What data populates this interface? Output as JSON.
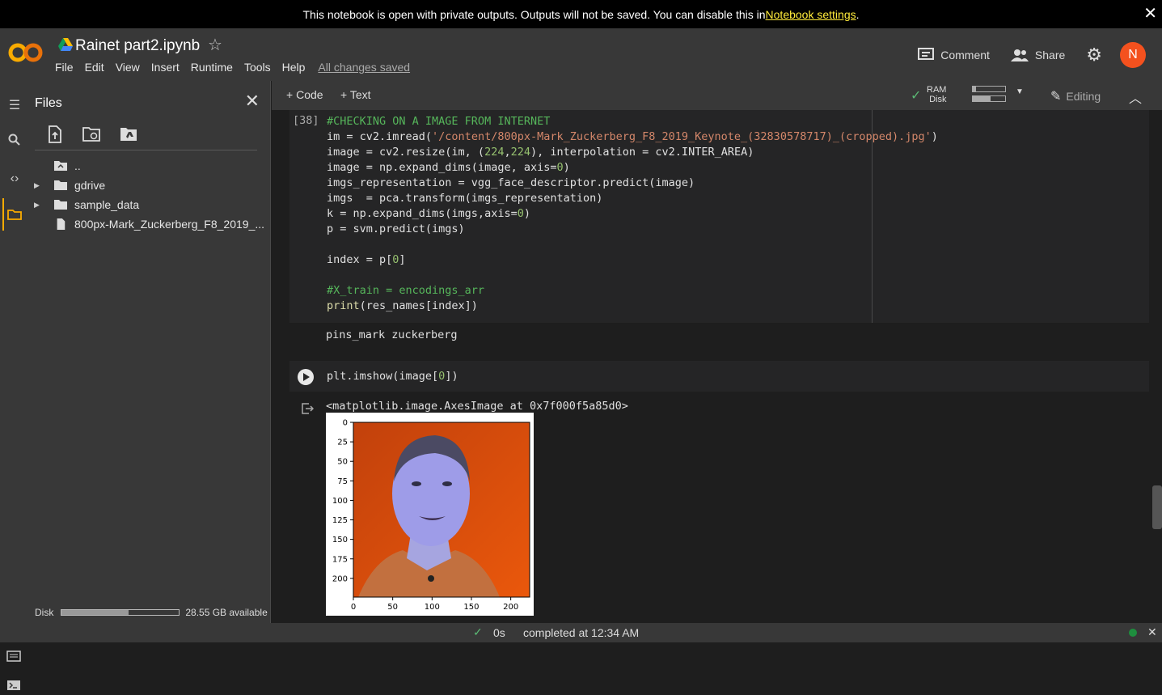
{
  "banner": {
    "text": "This notebook is open with private outputs. Outputs will not be saved. You can disable this in ",
    "link": "Notebook settings",
    "suffix": "."
  },
  "header": {
    "title": "Rainet part2.ipynb",
    "menu": [
      "File",
      "Edit",
      "View",
      "Insert",
      "Runtime",
      "Tools",
      "Help"
    ],
    "saved_status": "All changes saved",
    "comment_label": "Comment",
    "share_label": "Share",
    "avatar_letter": "N",
    "avatar_color": "#f4511e"
  },
  "files_panel": {
    "title": "Files",
    "items": [
      {
        "name": "..",
        "type": "parent"
      },
      {
        "name": "gdrive",
        "type": "folder"
      },
      {
        "name": "sample_data",
        "type": "folder"
      },
      {
        "name": "800px-Mark_Zuckerberg_F8_2019_...",
        "type": "file"
      }
    ],
    "disk_label": "Disk",
    "disk_available": "28.55 GB available",
    "disk_used_fraction": 0.57
  },
  "toolbar": {
    "code_label": "Code",
    "text_label": "Text",
    "ram_label": "RAM",
    "disk_label": "Disk",
    "ram_fraction": 0.1,
    "disk_fraction": 0.55,
    "editing_label": "Editing"
  },
  "cell1": {
    "prompt": "[38]",
    "output": "pins_mark zuckerberg"
  },
  "cell2": {
    "code": "plt.imshow(image[0])",
    "output": "<matplotlib.image.AxesImage at 0x7f000f5a85d0>"
  },
  "plot": {
    "y_ticks": [
      "0",
      "25",
      "50",
      "75",
      "100",
      "125",
      "150",
      "175",
      "200"
    ],
    "x_ticks": [
      "0",
      "50",
      "100",
      "150",
      "200"
    ]
  },
  "status": {
    "elapsed": "0s",
    "completed": "completed at 12:34 AM"
  }
}
